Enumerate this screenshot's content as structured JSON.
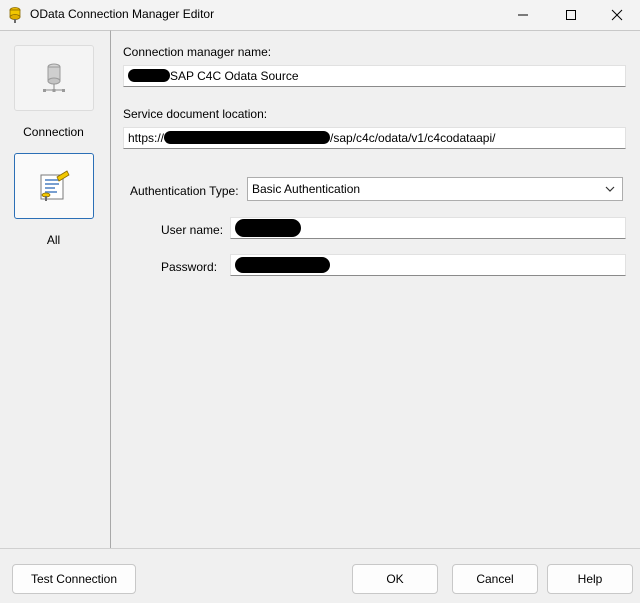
{
  "window": {
    "title": "OData Connection Manager Editor"
  },
  "sidebar": {
    "items": [
      {
        "label": "Connection",
        "icon": "database-icon"
      },
      {
        "label": "All",
        "icon": "properties-icon"
      }
    ]
  },
  "main": {
    "connection_name_label": "Connection manager name:",
    "connection_name_value": "SAP C4C Odata Source",
    "service_location_label": "Service document location:",
    "service_location_prefix": "https://",
    "service_location_suffix": "/sap/c4c/odata/v1/c4codataapi/",
    "auth_type_label": "Authentication Type:",
    "auth_type_value": "Basic Authentication",
    "username_label": "User name:",
    "password_label": "Password:"
  },
  "footer": {
    "test_connection": "Test Connection",
    "ok": "OK",
    "cancel": "Cancel",
    "help": "Help"
  }
}
